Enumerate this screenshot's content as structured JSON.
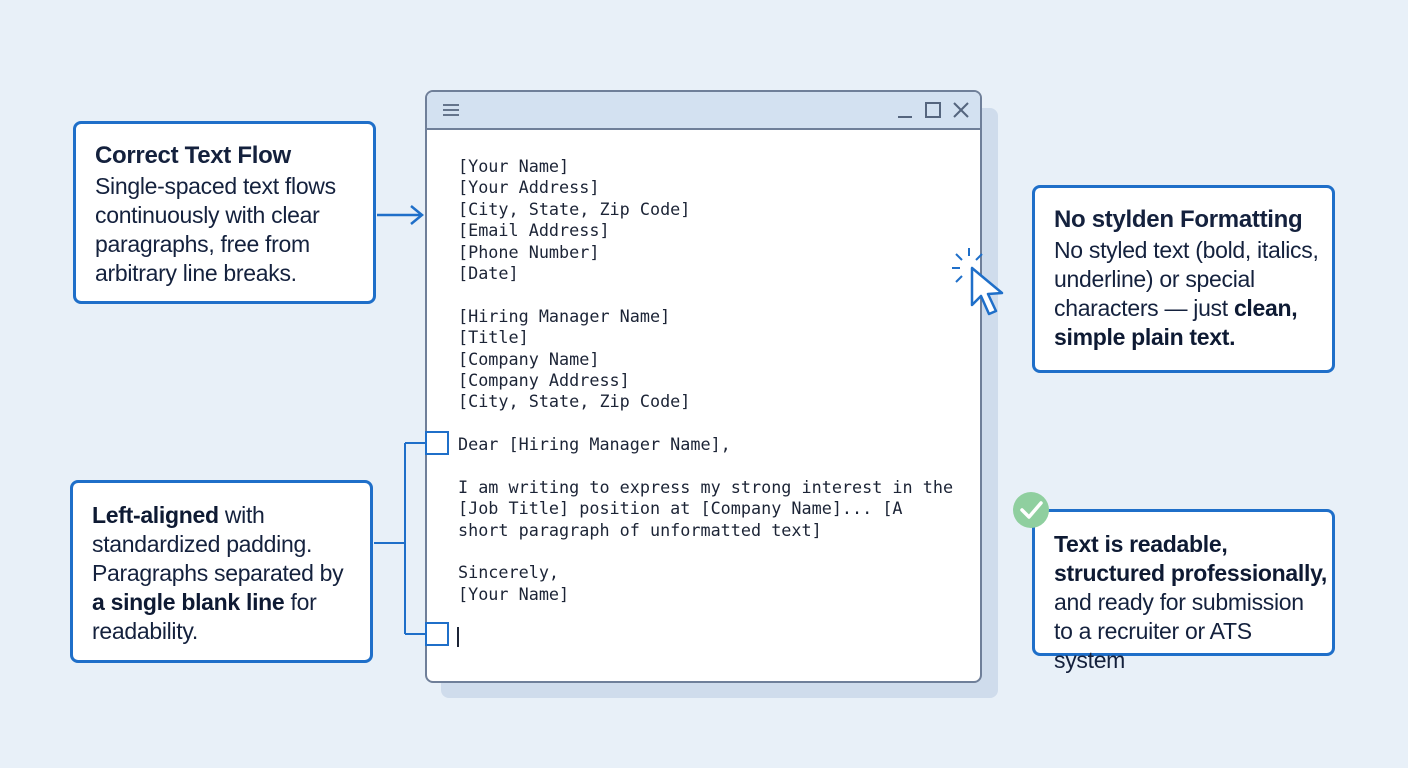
{
  "callouts": {
    "text_flow": {
      "title": "Correct Text Flow",
      "body": "Single-spaced text flows continuously with clear paragraphs, free from arbitrary line breaks."
    },
    "alignment": {
      "bold1": "Left-aligned",
      "text1": " with standardized padding. Paragraphs separated by ",
      "bold2": "a single blank line",
      "text2": " for readability."
    },
    "formatting": {
      "title": "No stylden Formatting",
      "text": "No styled text (bold, italics, underline) or special characters — just ",
      "bold": "clean, simple plain text."
    },
    "readable": {
      "bold": "Text is readable, structured professionally,",
      "text": " and ready for submission to a recruiter or ATS system"
    }
  },
  "document": {
    "lines": [
      "[Your Name]",
      "[Your Address]",
      "[City, State, Zip Code]",
      "[Email Address]",
      "[Phone Number]",
      "[Date]",
      "",
      "[Hiring Manager Name]",
      "[Title]",
      "[Company Name]",
      "[Company Address]",
      "[City, State, Zip Code]",
      "",
      "Dear [Hiring Manager Name],",
      "",
      "I am writing to express my strong interest in the",
      "[Job Title] position at [Company Name]... [A",
      "short paragraph of unformatted text]",
      "",
      "Sincerely,",
      "[Your Name]"
    ]
  },
  "window_controls": [
    "menu-icon",
    "minimize-icon",
    "maximize-icon",
    "close-icon"
  ],
  "colors": {
    "accent": "#1f6fc9",
    "background": "#e8f0f8",
    "titlebar": "#d3e1f1",
    "check": "#8fcf9f"
  }
}
